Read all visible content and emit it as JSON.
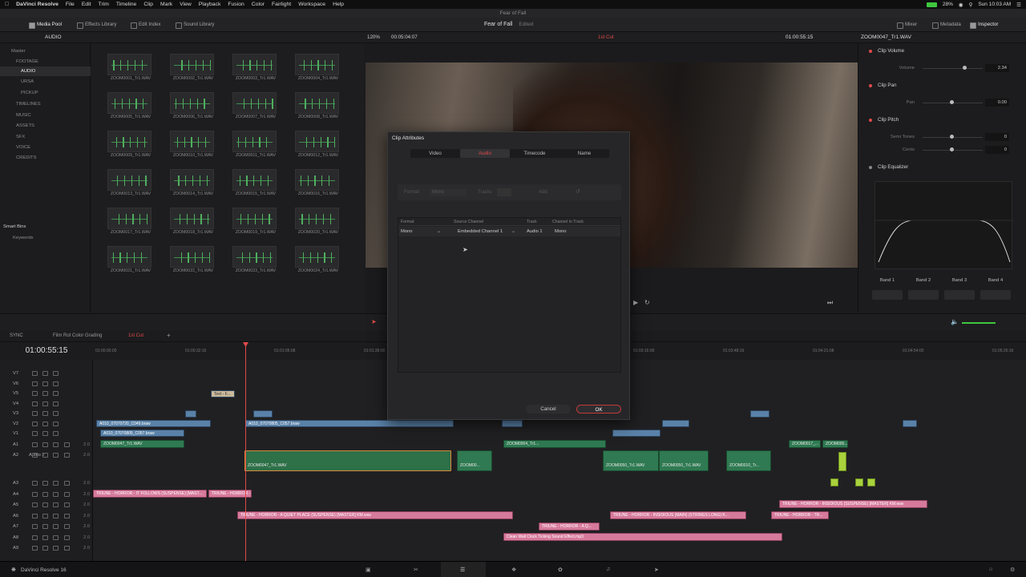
{
  "menubar": {
    "app": "DaVinci Resolve",
    "items": [
      "File",
      "Edit",
      "Trim",
      "Timeline",
      "Clip",
      "Mark",
      "View",
      "Playback",
      "Fusion",
      "Color",
      "Fairlight",
      "Workspace",
      "Help"
    ],
    "battery": "28%",
    "clock": "Sun 10:03 AM"
  },
  "window_title": "Fear of Fall",
  "toolbar": {
    "media_pool": "Media Pool",
    "effects_library": "Effects Library",
    "edit_index": "Edit Index",
    "sound_library": "Sound Library",
    "project_name": "Fear of Fall",
    "project_status": "Edited",
    "mixer": "Mixer",
    "metadata": "Metadata",
    "inspector": "Inspector"
  },
  "bar2": {
    "bin_name": "AUDIO",
    "zoom": "120%",
    "source_tc": "00:05:04:07",
    "timeline_name": "1st Cut",
    "record_tc": "01:00:55:15",
    "inspector_clip": "ZOOM0047_Tr1.WAV"
  },
  "bins": {
    "master": "Master",
    "items": [
      "FOOTAGE",
      "AUDIO",
      "URSA",
      "PICKUP",
      "TIMELINES",
      "MUSIC",
      "ASSETS",
      "SFX",
      "VOICE",
      "CREDITS"
    ],
    "smart_bins": "Smart Bins",
    "keywords": "Keywords"
  },
  "clips": [
    "ZOOM0001_Tr1.WAV",
    "ZOOM0002_Tr1.WAV",
    "ZOOM0003_Tr1.WAV",
    "ZOOM0004_Tr1.WAV",
    "ZOOM0005_Tr1.WAV",
    "ZOOM0006_Tr1.WAV",
    "ZOOM0007_Tr1.WAV",
    "ZOOM0008_Tr1.WAV",
    "ZOOM0009_Tr1.WAV",
    "ZOOM0010_Tr1.WAV",
    "ZOOM0011_Tr1.WAV",
    "ZOOM0012_Tr1.WAV",
    "ZOOM0013_Tr1.WAV",
    "ZOOM0014_Tr1.WAV",
    "ZOOM0015_Tr1.WAV",
    "ZOOM0016_Tr1.WAV",
    "ZOOM0017_Tr1.WAV",
    "ZOOM0018_Tr1.WAV",
    "ZOOM0019_Tr1.WAV",
    "ZOOM0020_Tr1.WAV",
    "ZOOM0021_Tr1.WAV",
    "ZOOM0022_Tr1.WAV",
    "ZOOM0023_Tr1.WAV",
    "ZOOM0024_Tr1.WAV"
  ],
  "inspector": {
    "clip_volume": "Clip Volume",
    "volume_label": "Volume",
    "volume_value": "2.34",
    "clip_pan": "Clip Pan",
    "pan_label": "Pan",
    "pan_value": "0.00",
    "clip_pitch": "Clip Pitch",
    "semi_tones_label": "Semi Tones",
    "semi_tones_value": "0",
    "cents_label": "Cents",
    "cents_value": "0",
    "clip_equalizer": "Clip Equalizer",
    "bands": [
      "Band 1",
      "Band 2",
      "Band 3",
      "Band 4"
    ]
  },
  "timeline": {
    "sync": "SYNC",
    "tab1": "Film Rot Color Grading",
    "tab2": "1st Cut",
    "timecode": "01:00:55:15",
    "ruler": [
      "01:00:00:00",
      "01:00:32:16",
      "01:01:05:08",
      "01:01:38:00",
      "01:03:16:00",
      "01:03:48:16",
      "01:04:21:08",
      "01:04:54:00",
      "01:05:26:16"
    ],
    "video_tracks": [
      "V7",
      "V6",
      "V5",
      "V4",
      "V3",
      "V2",
      "V1"
    ],
    "audio_tracks": [
      {
        "id": "A1",
        "name": "",
        "vol": "2.0"
      },
      {
        "id": "A2",
        "name": "Audio 2",
        "vol": "2.0"
      },
      {
        "id": "A3",
        "name": "",
        "vol": "2.0"
      },
      {
        "id": "A4",
        "name": "",
        "vol": "2.0"
      },
      {
        "id": "A5",
        "name": "",
        "vol": "2.0"
      },
      {
        "id": "A6",
        "name": "",
        "vol": "2.0"
      },
      {
        "id": "A7",
        "name": "",
        "vol": "2.0"
      },
      {
        "id": "A8",
        "name": "",
        "vol": "2.0"
      },
      {
        "id": "A9",
        "name": "",
        "vol": "2.0"
      }
    ],
    "clips": {
      "text_clip": "Text - F...",
      "v2_a": "A010_07070720_C049.braw",
      "v2_b": "A010_07070805_C057.braw",
      "v1_a": "A010_07070805_C057.braw",
      "a1_a": "ZOOM0047_Tr1.WAV",
      "a2_a": "ZOOM0047_Tr1.WAV",
      "a2_b": "ZOOM00...",
      "a1_b": "ZOOM0004_Tr1...",
      "a2_c": "ZOOM0050_Tr1.WAV",
      "a2_d": "ZOOM0050_Tr1.WAV",
      "a2_e": "ZOOM0010_Tr...",
      "a1_c": "ZOOM0017_...",
      "a1_d": "ZOOM000...",
      "a4_a": "TRIUNE - HORROR - IT FOLLOWS (SUSPENSE) [MAST...",
      "a4_b": "TRIUNE - HORROR -...",
      "a6_a": "TRIUNE - HORROR - A QUIET PLACE (SUSPENSE) [MASTER] KM.wav",
      "a5_a": "TRIUNE - HORROR - INSIDIOUS (SUSPENSE) [MASTER] KM.wav",
      "a6_b": "TRIUNE - HORROR - INSIDIOUS (MAIN) (STRINGS LONG) K...",
      "a7_a": "TRIUNE - HORROR - A Q...",
      "a8_a": "Clean Wall Clock Ticking Sound Effect.mp3",
      "a6_c": "TRIUNE - HORROR - TR..."
    }
  },
  "dialog": {
    "title": "Clip Attributes",
    "tabs": [
      "Video",
      "Audio",
      "Timecode",
      "Name"
    ],
    "active_tab": "Audio",
    "format_label": "Format",
    "format_value": "Mono",
    "tracks_label": "Tracks",
    "add_label": "Add",
    "columns": [
      "Format",
      "Source Channel",
      "Track",
      "Channel in Track"
    ],
    "row": {
      "format": "Mono",
      "source_channel": "Embedded Channel 1",
      "track": "Audio 1",
      "channel_in_track": "Mono"
    },
    "cancel": "Cancel",
    "ok": "OK"
  },
  "bottombar": {
    "app_name": "DaVinci Resolve 16"
  },
  "colors": {
    "accent": "#e24a4a",
    "video_clip": "#5a82a8",
    "audio_clip": "#2f7a52",
    "music_clip": "#d67a9c"
  }
}
